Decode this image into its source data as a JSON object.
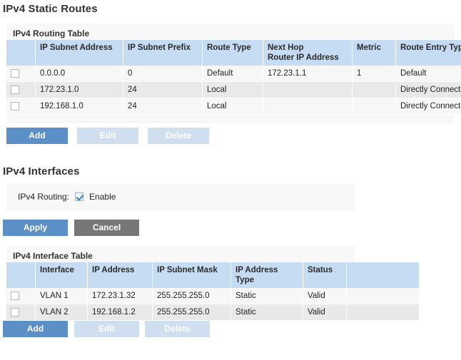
{
  "sections": {
    "static_routes": {
      "heading": "IPv4 Static Routes",
      "panel_title": "IPv4 Routing Table",
      "table": {
        "headers": {
          "select": "",
          "subnet_address": "IP Subnet Address",
          "subnet_prefix": "IP Subnet Prefix",
          "route_type": "Route Type",
          "next_hop_line1": "Next Hop",
          "next_hop_line2": "Router IP Address",
          "metric": "Metric",
          "route_entry_type": "Route Entry Type",
          "pad": ""
        },
        "rows": [
          {
            "selected": false,
            "subnet_address": "0.0.0.0",
            "subnet_prefix": "0",
            "route_type": "Default",
            "next_hop": "172.23.1.1",
            "metric": "1",
            "route_entry_type": "Default"
          },
          {
            "selected": false,
            "subnet_address": "172.23.1.0",
            "subnet_prefix": "24",
            "route_type": "Local",
            "next_hop": "",
            "metric": "",
            "route_entry_type": "Directly Connected"
          },
          {
            "selected": false,
            "subnet_address": "192.168.1.0",
            "subnet_prefix": "24",
            "route_type": "Local",
            "next_hop": "",
            "metric": "",
            "route_entry_type": "Directly Connected"
          }
        ]
      },
      "buttons": {
        "add": "Add",
        "edit": "Edit",
        "delete": "Delete"
      }
    },
    "interfaces": {
      "heading": "IPv4 Interfaces",
      "routing_field": {
        "label": "IPv4 Routing:",
        "checkbox_label": "Enable",
        "checked": true
      },
      "buttons": {
        "apply": "Apply",
        "cancel": "Cancel"
      },
      "panel_title": "IPv4 Interface Table",
      "table": {
        "headers": {
          "select": "",
          "interface": "Interface",
          "ip_address": "IP Address",
          "subnet_mask": "IP Subnet Mask",
          "address_type": "IP Address Type",
          "status": "Status",
          "pad": ""
        },
        "rows": [
          {
            "selected": false,
            "interface": "VLAN 1",
            "ip_address": "172.23.1.32",
            "subnet_mask": "255.255.255.0",
            "address_type": "Static",
            "status": "Valid"
          },
          {
            "selected": false,
            "interface": "VLAN 2",
            "ip_address": "192.168.1.2",
            "subnet_mask": "255.255.255.0",
            "address_type": "Static",
            "status": "Valid"
          }
        ]
      },
      "table_buttons": {
        "add": "Add",
        "edit": "Edit",
        "delete": "Delete"
      }
    }
  },
  "colors": {
    "table_header_blue": "#c6dcf2",
    "button_primary_blue": "#5b8fc6",
    "button_disabled_blue": "#cfdff0",
    "button_cancel_gray": "#777777",
    "row_odd": "#f7f7f7",
    "row_even": "#e9e9e9",
    "panel_background": "#f8f8f8",
    "checkmark_blue": "#2f7fd1"
  }
}
